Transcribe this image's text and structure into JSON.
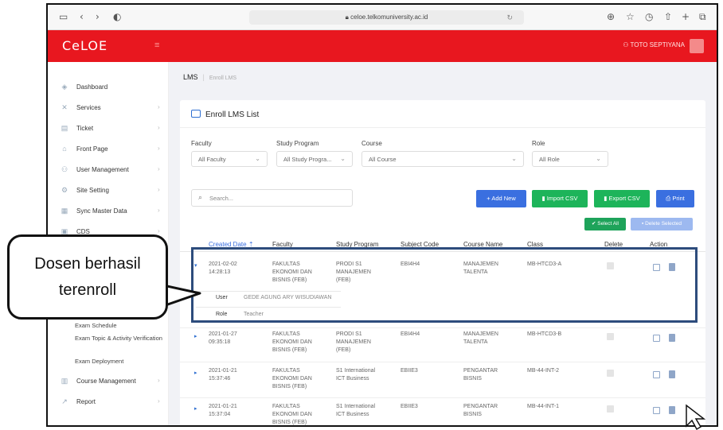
{
  "browser": {
    "url": "celoe.telkomuniversity.ac.id"
  },
  "appbar": {
    "logo": "CeLOE",
    "user_name": "TOTO SEPTIYANA"
  },
  "sidebar": {
    "items": [
      {
        "label": "Dashboard"
      },
      {
        "label": "Services"
      },
      {
        "label": "Ticket"
      },
      {
        "label": "Front Page"
      },
      {
        "label": "User Management"
      },
      {
        "label": "Site Setting"
      },
      {
        "label": "Sync Master Data"
      },
      {
        "label": "CDS"
      },
      {
        "label": "Course Management"
      },
      {
        "label": "Report"
      }
    ],
    "sub_items": [
      {
        "label": "Exam Schedule"
      },
      {
        "label": "Exam Topic & Activity Verification"
      },
      {
        "label": "Exam Deployment"
      }
    ]
  },
  "breadcrumb": {
    "root": "LMS",
    "current": "Enroll LMS"
  },
  "card": {
    "title": "Enroll LMS List"
  },
  "filters": {
    "faculty": {
      "label": "Faculty",
      "value": "All Faculty"
    },
    "program": {
      "label": "Study Program",
      "value": "All Study Progra..."
    },
    "course": {
      "label": "Course",
      "value": "All Course"
    },
    "role": {
      "label": "Role",
      "value": "All Role"
    }
  },
  "search": {
    "placeholder": "Search..."
  },
  "buttons": {
    "add_new": "Add New",
    "import_csv": "Import CSV",
    "export_csv": "Export CSV",
    "print": "Print",
    "select_all": "Select All",
    "delete_selected": "Delete Selected"
  },
  "table": {
    "headers": {
      "created": "Created Date",
      "faculty": "Faculty",
      "program": "Study Program",
      "subject": "Subject Code",
      "course": "Course Name",
      "class": "Class",
      "delete": "Delete",
      "action": "Action"
    },
    "rows": [
      {
        "date": "2021-02-02",
        "time": "14:28:13",
        "faculty": [
          "FAKULTAS",
          "EKONOMI DAN",
          "BISNIS (FEB)"
        ],
        "program": [
          "PRODI S1",
          "MANAJEMEN",
          "(FEB)"
        ],
        "subject": "EBI4H4",
        "course": [
          "MANAJEMEN",
          "TALENTA"
        ],
        "class": "MB-HTCD3-A"
      },
      {
        "date": "2021-01-27",
        "time": "09:35:18",
        "faculty": [
          "FAKULTAS",
          "EKONOMI DAN",
          "BISNIS (FEB)"
        ],
        "program": [
          "PRODI S1",
          "MANAJEMEN",
          "(FEB)"
        ],
        "subject": "EBI4H4",
        "course": [
          "MANAJEMEN",
          "TALENTA"
        ],
        "class": "MB-HTCD3-B"
      },
      {
        "date": "2021-01-21",
        "time": "15:37:46",
        "faculty": [
          "FAKULTAS",
          "EKONOMI DAN",
          "BISNIS (FEB)"
        ],
        "program": [
          "S1 International",
          "ICT Business"
        ],
        "subject": "EBIIE3",
        "course": [
          "PENGANTAR",
          "BISNIS"
        ],
        "class": "MB-44-INT-2"
      },
      {
        "date": "2021-01-21",
        "time": "15:37:04",
        "faculty": [
          "FAKULTAS",
          "EKONOMI DAN",
          "BISNIS (FEB)"
        ],
        "program": [
          "S1 International",
          "ICT Business"
        ],
        "subject": "EBIIE3",
        "course": [
          "PENGANTAR",
          "BISNIS"
        ],
        "class": "MB-44-INT-1"
      }
    ],
    "detail": {
      "user_label": "User",
      "user_value": "GEDE AGUNG ARY WISUDIAWAN",
      "role_label": "Role",
      "role_value": "Teacher"
    }
  },
  "callout": {
    "line1": "Dosen berhasil",
    "line2": "terenroll"
  }
}
